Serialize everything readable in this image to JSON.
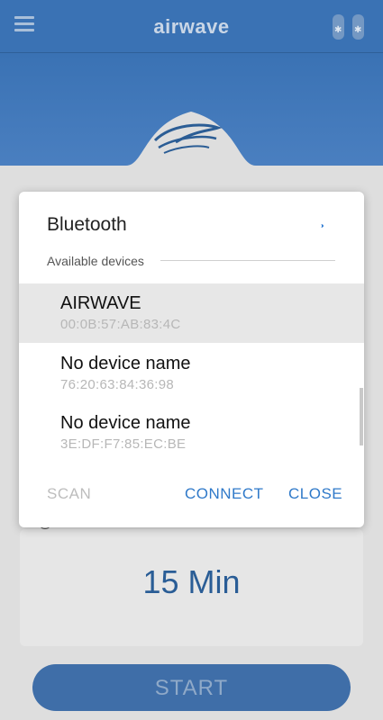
{
  "app": {
    "logo": "airwave",
    "timer": "15 Min",
    "start_label": "START",
    "colors": {
      "header": "#3a72b4",
      "accent": "#2f79c9"
    }
  },
  "dialog": {
    "title": "Bluetooth",
    "section_label": "Available devices",
    "devices": [
      {
        "name": "AIRWAVE",
        "address": "00:0B:57:AB:83:4C",
        "selected": true
      },
      {
        "name": "No device name",
        "address": "76:20:63:84:36:98",
        "selected": false
      },
      {
        "name": "No device name",
        "address": "3E:DF:F7:85:EC:BE",
        "selected": false
      }
    ],
    "buttons": {
      "scan": "SCAN",
      "connect": "CONNECT",
      "close": "CLOSE"
    }
  },
  "icons": [
    "menu-icon",
    "bluetooth-icon",
    "wave-icon",
    "timer-icon"
  ]
}
